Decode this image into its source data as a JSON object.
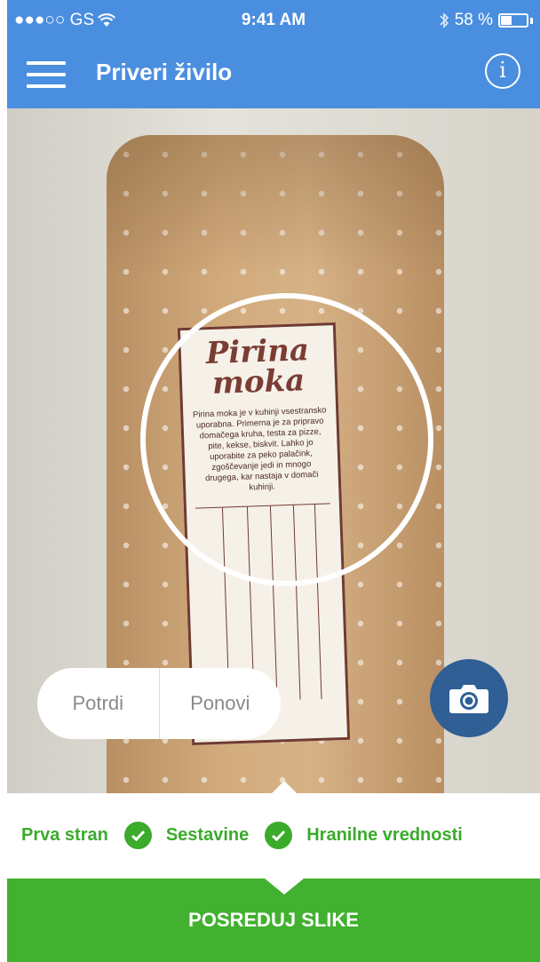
{
  "status_bar": {
    "carrier": "●●●○○ GS",
    "time": "9:41 AM",
    "battery_percent": "58 %"
  },
  "nav": {
    "title": "Priveri živilo",
    "info_glyph": "i",
    "menu_icon": "hamburger-icon",
    "info_icon": "info-icon"
  },
  "camera": {
    "label_title_line1": "Pirina",
    "label_title_line2": "moka",
    "label_description": "Pirina moka je v kuhinji vsestransko uporabna. Primerna je za pripravo domačega kruha, testa za pizze, pite, kekse, biskvit. Lahko jo uporabite za peko palačink, zgoščevanje jedi in mnogo drugega, kar nastaja v domači kuhinji.",
    "confirm_label": "Potrdi",
    "retry_label": "Ponovi",
    "shutter_icon": "camera-icon"
  },
  "steps": [
    {
      "label": "Prva stran",
      "done": true
    },
    {
      "label": "Sestavine",
      "done": true
    },
    {
      "label": "Hranilne vrednosti",
      "done": false
    }
  ],
  "cta": {
    "label": "POSREDUJ SLIKE"
  },
  "colors": {
    "header": "#4a8ee0",
    "accent_green": "#3aab2b",
    "cta_green": "#41b12f",
    "shutter_blue": "#2f5f94"
  }
}
